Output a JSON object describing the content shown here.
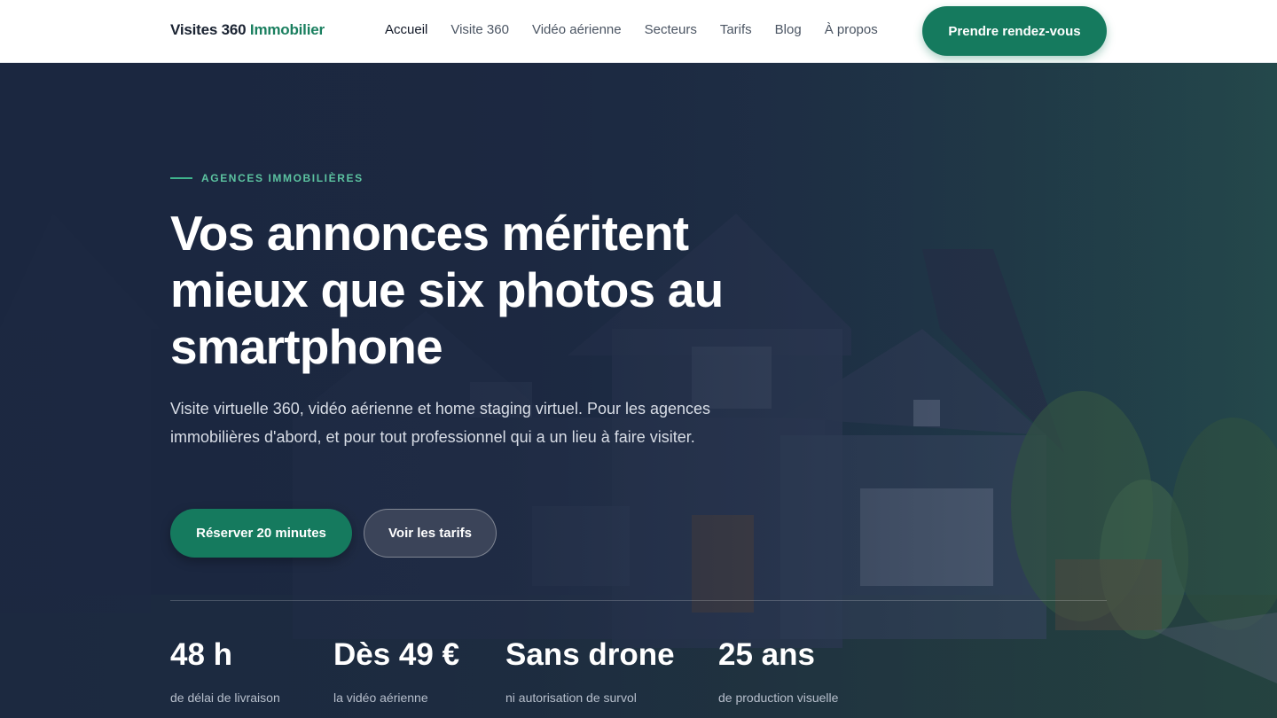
{
  "header": {
    "logo": {
      "text": "Visites 360",
      "accent": "Immobilier"
    },
    "nav": [
      {
        "label": "Accueil"
      },
      {
        "label": "Visite 360"
      },
      {
        "label": "Vidéo aérienne"
      },
      {
        "label": "Secteurs"
      },
      {
        "label": "Tarifs"
      },
      {
        "label": "Blog"
      },
      {
        "label": "À propos"
      }
    ],
    "cta_label": "Prendre rendez-vous"
  },
  "hero": {
    "eyebrow": "AGENCES IMMOBILIÈRES",
    "title": "Vos annonces méritent mieux que six photos au smartphone",
    "subtitle": "Visite virtuelle 360, vidéo aérienne et home staging virtuel. Pour les agences immobilières d'abord, et pour tout professionnel qui a un lieu à faire visiter.",
    "primary_button": "Réserver 20 minutes",
    "secondary_button": "Voir les tarifs",
    "stats": [
      {
        "value": "48 h",
        "label": "de délai de livraison"
      },
      {
        "value": "Dès 49 €",
        "label": "la vidéo aérienne"
      },
      {
        "value": "Sans drone",
        "label": "ni autorisation de survol"
      },
      {
        "value": "25 ans",
        "label": "de production visuelle"
      }
    ]
  },
  "colors": {
    "brand_green": "#157a5e",
    "accent_text": "#5cc3a0",
    "hero_bg": "#1b2740"
  }
}
